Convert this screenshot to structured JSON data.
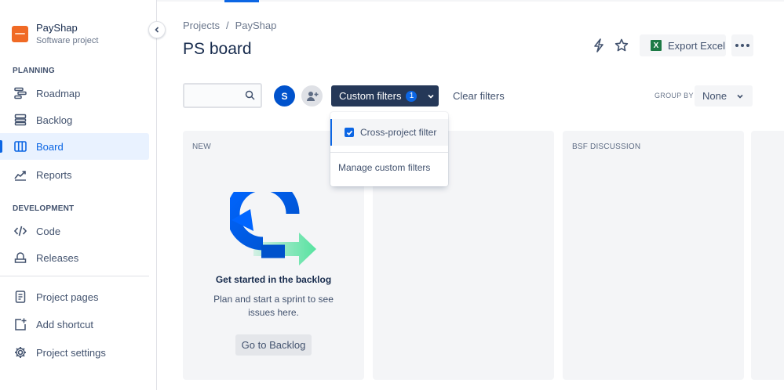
{
  "project": {
    "name": "PayShap",
    "type": "Software project"
  },
  "sidebar": {
    "planning_label": "PLANNING",
    "planning_items": [
      {
        "label": "Roadmap",
        "icon": "roadmap-icon"
      },
      {
        "label": "Backlog",
        "icon": "backlog-icon"
      },
      {
        "label": "Board",
        "icon": "board-icon",
        "active": true
      },
      {
        "label": "Reports",
        "icon": "reports-icon"
      }
    ],
    "development_label": "DEVELOPMENT",
    "development_items": [
      {
        "label": "Code",
        "icon": "code-icon"
      },
      {
        "label": "Releases",
        "icon": "releases-icon"
      }
    ],
    "footer_items": [
      {
        "label": "Project pages",
        "icon": "pages-icon"
      },
      {
        "label": "Add shortcut",
        "icon": "add-shortcut-icon"
      },
      {
        "label": "Project settings",
        "icon": "settings-icon"
      }
    ]
  },
  "breadcrumb": {
    "root": "Projects",
    "separator": "/",
    "current": "PayShap"
  },
  "page": {
    "title": "PS board"
  },
  "header_actions": {
    "export_label": "Export Excel"
  },
  "toolbar": {
    "search_placeholder": "",
    "avatar_initial": "S",
    "custom_filters_label": "Custom filters",
    "custom_filters_count": "1",
    "clear_filters_label": "Clear filters",
    "group_by_label": "GROUP BY",
    "group_by_value": "None"
  },
  "dropdown": {
    "items": [
      {
        "label": "Cross-project filter",
        "checked": true
      },
      {
        "label": "Manage custom filters"
      }
    ]
  },
  "columns": [
    {
      "title": "NEW"
    },
    {
      "title": ""
    },
    {
      "title": "BSF DISCUSSION"
    }
  ],
  "empty_state": {
    "title": "Get started in the backlog",
    "text": "Plan and start a sprint to see issues here.",
    "button": "Go to Backlog"
  },
  "colors": {
    "accent": "#0c66e4",
    "dark_button": "#253858",
    "project_logo": "#f06a25",
    "excel_green": "#1d7a45"
  }
}
